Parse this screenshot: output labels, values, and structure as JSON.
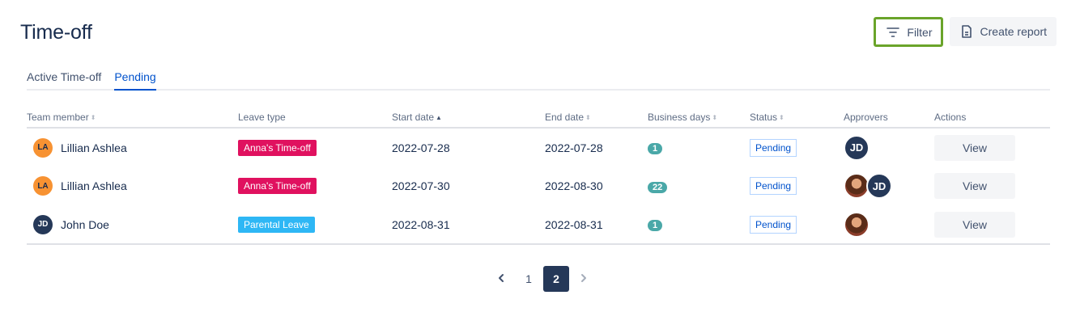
{
  "header": {
    "title": "Time-off",
    "filter_label": "Filter",
    "create_report_label": "Create report"
  },
  "tabs": [
    {
      "label": "Active Time-off",
      "active": false
    },
    {
      "label": "Pending",
      "active": true
    }
  ],
  "table": {
    "columns": [
      "Team member",
      "Leave type",
      "Start date",
      "End date",
      "Business days",
      "Status",
      "Approvers",
      "Actions"
    ],
    "rows": [
      {
        "member": {
          "name": "Lillian Ashlea",
          "initials": "LA"
        },
        "leave_type": "Anna's Time-off",
        "start_date": "2022-07-28",
        "end_date": "2022-07-28",
        "business_days": "1",
        "status": "Pending",
        "approvers": [
          "JD"
        ],
        "action": "View"
      },
      {
        "member": {
          "name": "Lillian Ashlea",
          "initials": "LA"
        },
        "leave_type": "Anna's Time-off",
        "start_date": "2022-07-30",
        "end_date": "2022-08-30",
        "business_days": "22",
        "status": "Pending",
        "approvers": [
          "photo",
          "JD"
        ],
        "action": "View"
      },
      {
        "member": {
          "name": "John Doe",
          "initials": "JD"
        },
        "leave_type": "Parental Leave",
        "start_date": "2022-08-31",
        "end_date": "2022-08-31",
        "business_days": "1",
        "status": "Pending",
        "approvers": [
          "photo"
        ],
        "action": "View"
      }
    ]
  },
  "pagination": {
    "pages": [
      "1",
      "2"
    ],
    "current": "2"
  },
  "colors": {
    "filter_border": "#6aa42a",
    "active_tab": "#0052cc",
    "leave_pink": "#e0115f",
    "leave_blue": "#2eb7f5",
    "days_badge": "#4aa8a8",
    "dark_navy": "#253858"
  },
  "icons": {
    "filter": "filter-lines-icon",
    "report": "document-icon",
    "prev": "chevron-left-icon",
    "next": "chevron-right-icon"
  }
}
